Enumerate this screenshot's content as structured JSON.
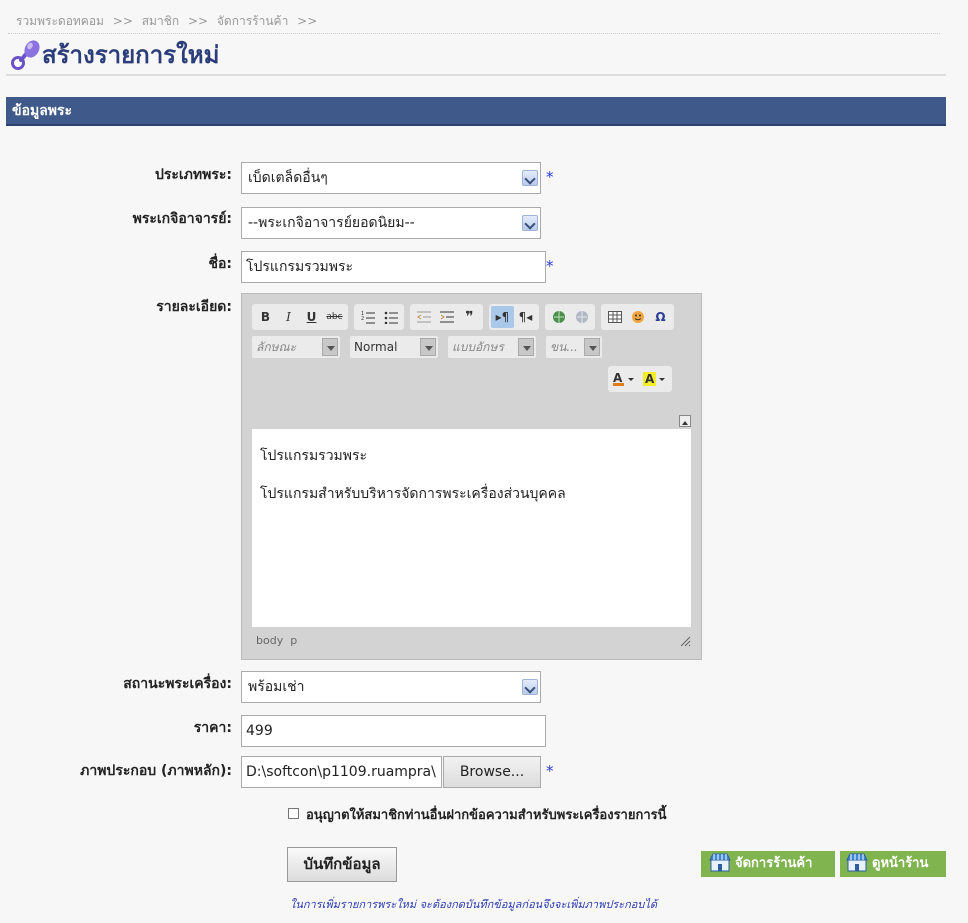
{
  "breadcrumb": [
    "รวมพระดอทคอม",
    ">>",
    "สมาชิก",
    ">>",
    "จัดการร้านค้า",
    ">>"
  ],
  "page_title": "สร้างรายการใหม่",
  "section_title": "ข้อมูลพระ",
  "form": {
    "type_label": "ประเภทพระ:",
    "type_value": "เบ็ดเตล็ดอื่นๆ",
    "monk_label": "พระเกจิอาจารย์:",
    "monk_value": "--พระเกจิอาจารย์ยอดนิยม--",
    "name_label": "ชื่อ:",
    "name_value": "โปรแกรมรวมพระ",
    "detail_label": "รายละเอียด:",
    "status_label": "สถานะพระเครื่อง:",
    "status_value": "พร้อมเช่า",
    "price_label": "ราคา:",
    "price_value": "499",
    "image_label": "ภาพประกอบ (ภาพหลัก):",
    "image_value": "D:\\softcon\\p1109.ruampra\\",
    "browse_label": "Browse...",
    "required_mark": "*"
  },
  "editor": {
    "style_combo": "ลักษณะ",
    "format_combo": "Normal",
    "font_combo": "แบบอักษร",
    "size_combo": "ขน...",
    "content_line1": "โปรแกรมรวมพระ",
    "content_line2": "โปรแกรมสำหรับบริหารจัดการพระเครื่องส่วนบุคคล",
    "path_body": "body",
    "path_p": "p"
  },
  "checkbox_label": "อนุญาตให้สมาชิกท่านอื่นฝากข้อความสำหรับพระเครื่องรายการนี้",
  "save_label": "บันทึกข้อมูล",
  "manage_shop_label": "จัดการร้านค้า",
  "view_shop_label": "ดูหน้าร้าน",
  "footnote": "ในการเพิ่มรายการพระใหม่ จะต้องกดบันทึกข้อมูลก่อนจึงจะเพิ่มภาพประกอบได้",
  "colors": {
    "section_bar": "#3f5a8a",
    "title": "#2b3d7a",
    "green_button": "#7fb44f",
    "required": "#2a3bd4"
  }
}
